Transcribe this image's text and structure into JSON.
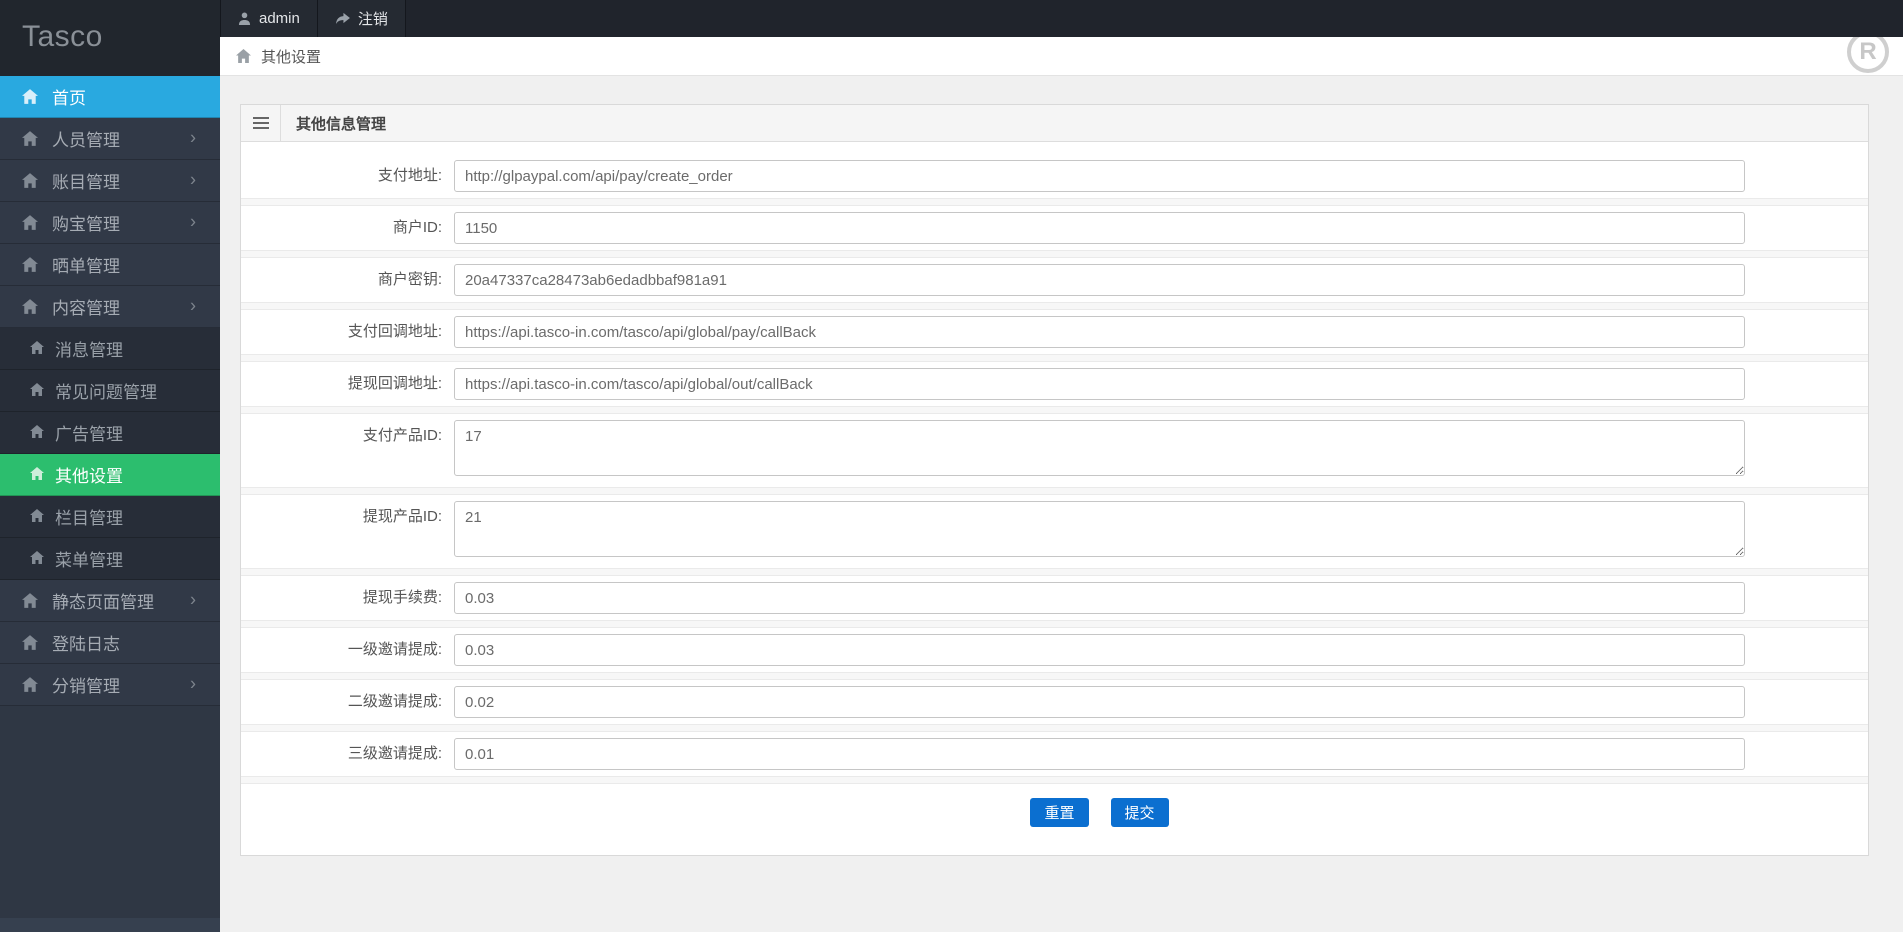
{
  "app": {
    "logo": "Tasco"
  },
  "topbar": {
    "user": "admin",
    "logout": "注销"
  },
  "breadcrumb": {
    "title": "其他设置"
  },
  "icons": {
    "chevron": "›",
    "registered_letter": "R"
  },
  "colors": {
    "active_blue": "#29a9e0",
    "active_green": "#2cbe6e",
    "button_blue": "#0b6fd0",
    "sidebar_bg": "#2f3744",
    "topbar_bg": "#20242c"
  },
  "sidebar": {
    "items": [
      {
        "label": "首页",
        "level": 1,
        "active": "blue"
      },
      {
        "label": "人员管理",
        "level": 1,
        "has_children": true
      },
      {
        "label": "账目管理",
        "level": 1,
        "has_children": true
      },
      {
        "label": "购宝管理",
        "level": 1,
        "has_children": true
      },
      {
        "label": "晒单管理",
        "level": 1
      },
      {
        "label": "内容管理",
        "level": 1,
        "has_children": true,
        "expanded": true
      },
      {
        "label": "消息管理",
        "level": 2
      },
      {
        "label": "常见问题管理",
        "level": 2
      },
      {
        "label": "广告管理",
        "level": 2
      },
      {
        "label": "其他设置",
        "level": 2,
        "active": "green"
      },
      {
        "label": "栏目管理",
        "level": 2
      },
      {
        "label": "菜单管理",
        "level": 2
      },
      {
        "label": "静态页面管理",
        "level": 1,
        "has_children": true
      },
      {
        "label": "登陆日志",
        "level": 1
      },
      {
        "label": "分销管理",
        "level": 1,
        "has_children": true
      }
    ]
  },
  "panel": {
    "title": "其他信息管理"
  },
  "form": {
    "fields": [
      {
        "label": "支付地址:",
        "value": "http://glpaypal.com/api/pay/create_order",
        "type": "input"
      },
      {
        "label": "商户ID:",
        "value": "1150",
        "type": "input"
      },
      {
        "label": "商户密钥:",
        "value": "20a47337ca28473ab6edadbbaf981a91",
        "type": "input"
      },
      {
        "label": "支付回调地址:",
        "value": "https://api.tasco-in.com/tasco/api/global/pay/callBack",
        "type": "input"
      },
      {
        "label": "提现回调地址:",
        "value": "https://api.tasco-in.com/tasco/api/global/out/callBack",
        "type": "input"
      },
      {
        "label": "支付产品ID:",
        "value": "17",
        "type": "textarea"
      },
      {
        "label": "提现产品ID:",
        "value": "21",
        "type": "textarea"
      },
      {
        "label": "提现手续费:",
        "value": "0.03",
        "type": "input"
      },
      {
        "label": "一级邀请提成:",
        "value": "0.03",
        "type": "input"
      },
      {
        "label": "二级邀请提成:",
        "value": "0.02",
        "type": "input"
      },
      {
        "label": "三级邀请提成:",
        "value": "0.01",
        "type": "input"
      }
    ],
    "buttons": {
      "reset": "重置",
      "submit": "提交"
    }
  }
}
